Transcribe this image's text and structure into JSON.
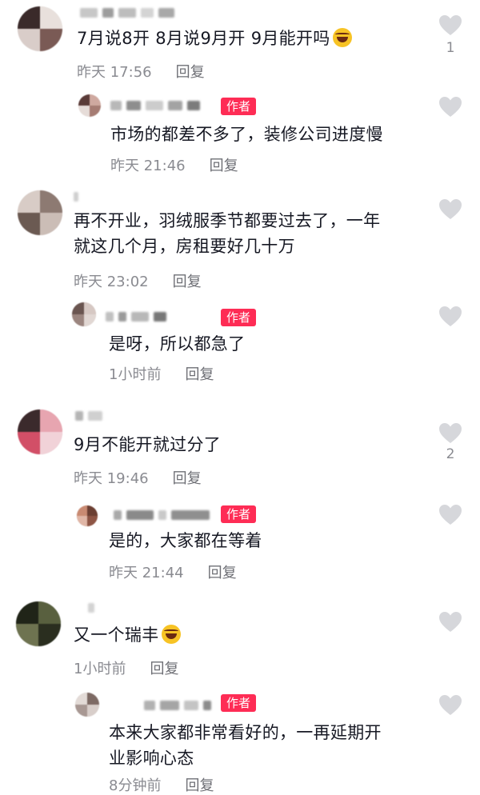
{
  "comments": [
    {
      "text": "7月说8开 8月说9月开 9月能开吗",
      "has_emoji": true,
      "time": "昨天 17:56",
      "reply_label": "回复",
      "likes": "1",
      "author_reply": {
        "badge": "作者",
        "text": "市场的都差不多了，装修公司进度慢",
        "time": "昨天 21:46",
        "reply_label": "回复"
      }
    },
    {
      "text_line1": "再不开业，羽绒服季节都要过去了，一年",
      "text_line2": "就这几个月，房租要好几十万",
      "time": "昨天 23:02",
      "reply_label": "回复",
      "author_reply": {
        "badge": "作者",
        "text": "是呀，所以都急了",
        "time": "1小时前",
        "reply_label": "回复"
      }
    },
    {
      "text": "9月不能开就过分了",
      "time": "昨天 19:46",
      "reply_label": "回复",
      "likes": "2",
      "author_reply": {
        "badge": "作者",
        "text": "是的，大家都在等着",
        "time": "昨天 21:44",
        "reply_label": "回复"
      }
    },
    {
      "text": "又一个瑞丰",
      "has_emoji": true,
      "time": "1小时前",
      "reply_label": "回复",
      "author_reply": {
        "badge": "作者",
        "text_line1": "本来大家都非常看好的，一再延期开",
        "text_line2": "业影响心态",
        "time": "8分钟前",
        "reply_label": "回复"
      }
    }
  ],
  "colors": {
    "badge": "#fe2c55",
    "meta_text": "#8a8b91",
    "heart": "#d6d7db"
  },
  "icons": {
    "like": "heart-icon",
    "laugh": "rofl-emoji-icon"
  }
}
